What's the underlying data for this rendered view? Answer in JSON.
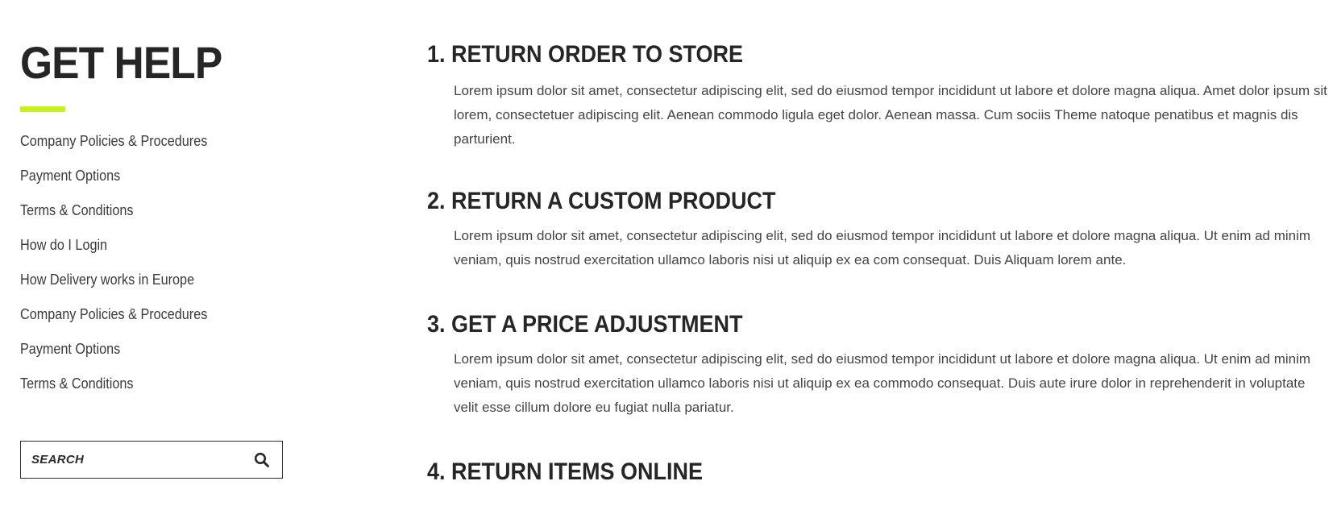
{
  "sidebar": {
    "title": "GET HELP",
    "accent_color": "#c9f21a",
    "links": [
      "Company Policies & Procedures",
      "Payment Options",
      "Terms & Conditions",
      "How do I Login",
      "How Delivery works in Europe",
      "Company Policies & Procedures",
      "Payment Options",
      "Terms & Conditions"
    ],
    "search": {
      "placeholder": "SEARCH",
      "icon": "search-icon"
    }
  },
  "sections": [
    {
      "heading": "1. RETURN ORDER TO STORE",
      "body": "Lorem ipsum dolor sit amet, consectetur adipiscing elit, sed do eiusmod tempor incididunt ut labore et dolore magna aliqua. Amet dolor ipsum sit lorem, consectetuer adipiscing elit. Aenean commodo ligula eget dolor. Aenean massa. Cum sociis Theme natoque penatibus et magnis dis parturient."
    },
    {
      "heading": "2. RETURN A CUSTOM PRODUCT",
      "body": "Lorem ipsum dolor sit amet, consectetur adipiscing elit, sed do eiusmod tempor incididunt ut labore et dolore magna aliqua. Ut enim ad minim veniam, quis nostrud exercitation ullamco laboris nisi ut aliquip ex ea com consequat. Duis Aliquam lorem ante."
    },
    {
      "heading": "3. GET A PRICE ADJUSTMENT",
      "body": "Lorem ipsum dolor sit amet, consectetur adipiscing elit, sed do eiusmod tempor incididunt ut labore et dolore magna aliqua. Ut enim ad minim veniam, quis nostrud exercitation ullamco laboris nisi ut aliquip ex ea commodo consequat. Duis aute irure dolor in reprehenderit in voluptate velit esse cillum dolore eu fugiat nulla pariatur."
    },
    {
      "heading": "4. RETURN ITEMS ONLINE",
      "body": ""
    }
  ]
}
